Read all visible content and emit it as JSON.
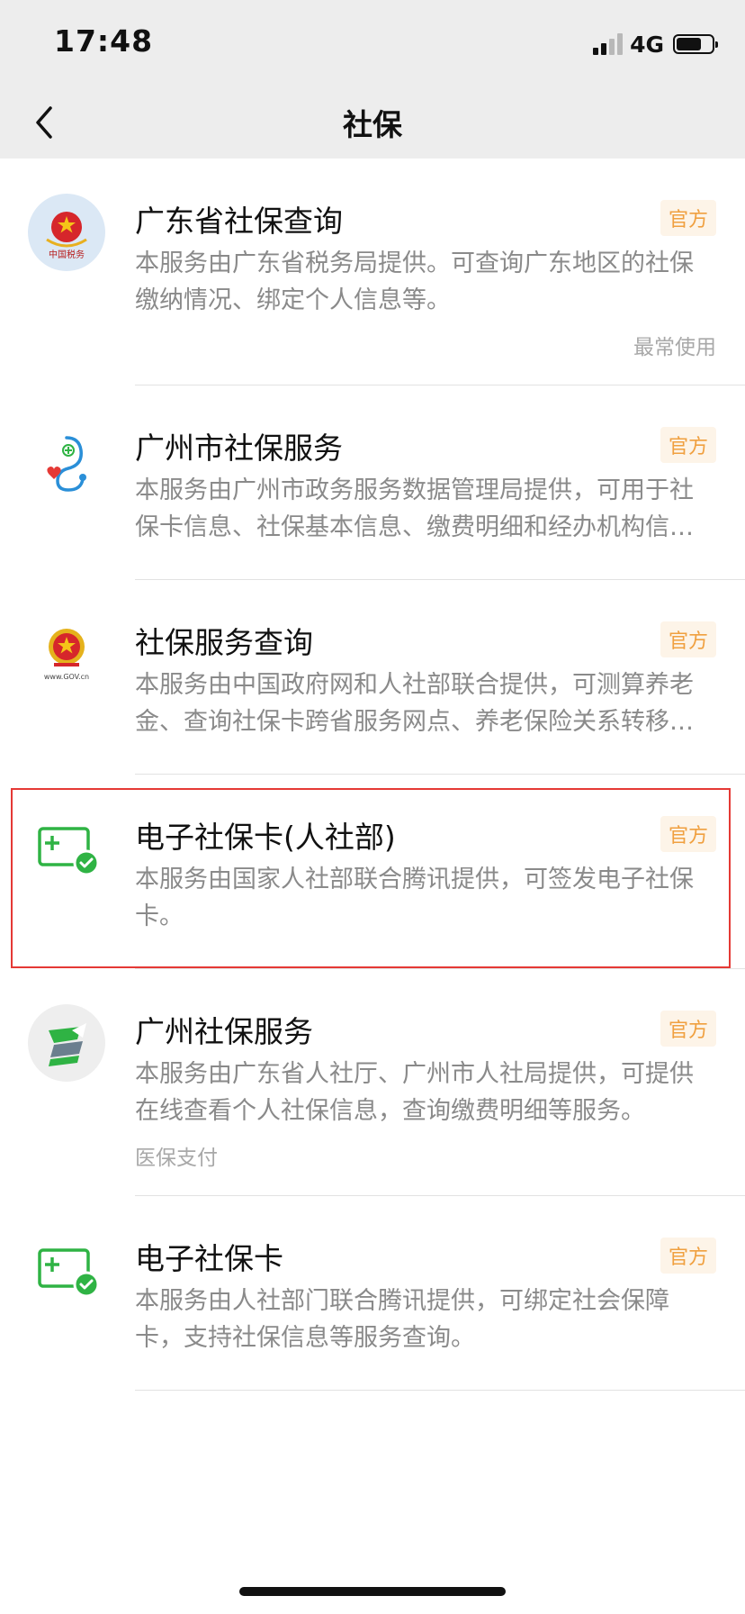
{
  "status_bar": {
    "time": "17:48",
    "network": "4G",
    "battery_percent": 72,
    "signal_bars": 2
  },
  "nav": {
    "title": "社保",
    "back_icon": "chevron-left-icon"
  },
  "items": [
    {
      "title": "广东省社保查询",
      "badge": "官方",
      "desc": "本服务由广东省税务局提供。可查询广东地区的社保缴纳情况、绑定个人信息等。",
      "tag": "最常使用",
      "icon": "china-tax-emblem-icon",
      "icon_text": "中国税务"
    },
    {
      "title": "广州市社保服务",
      "badge": "官方",
      "desc": "本服务由广州市政务服务数据管理局提供，可用于社保卡信息、社保基本信息、缴费明细和经办机构信息查询等服务。",
      "icon": "stethoscope-icon"
    },
    {
      "title": "社保服务查询",
      "badge": "官方",
      "desc": "本服务由中国政府网和人社部联合提供，可测算养老金、查询社保卡跨省服务网点、养老保险关系转移接续等服务。",
      "icon": "national-emblem-icon",
      "icon_text": "www.GOV.cn"
    },
    {
      "title": "电子社保卡(人社部)",
      "badge": "官方",
      "desc": "本服务由国家人社部联合腾讯提供，可签发电子社保卡。",
      "icon": "e-social-card-icon",
      "highlighted": true
    },
    {
      "title": "广州社保服务",
      "badge": "官方",
      "desc": "本服务由广东省人社厅、广州市人社局提供，可提供在线查看个人社保信息，查询缴费明细等服务。",
      "tag": "医保支付",
      "icon": "guangzhou-social-logo-icon"
    },
    {
      "title": "电子社保卡",
      "badge": "官方",
      "desc": "本服务由人社部门联合腾讯提供，可绑定社会保障卡，支持社保信息等服务查询。",
      "icon": "e-social-card-icon"
    }
  ],
  "colors": {
    "badge_text": "#f0a040",
    "badge_bg": "#fdf4e8",
    "highlight_border": "#e53935",
    "icon_green": "#2fb344",
    "header_bg": "#ededed"
  }
}
